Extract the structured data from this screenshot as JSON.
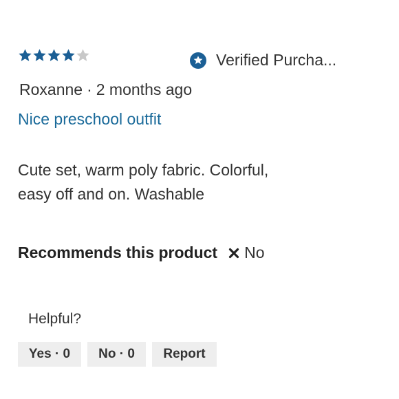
{
  "review": {
    "rating": 4,
    "max_rating": 5,
    "verified_label": "Verified Purcha...",
    "author": "Roxanne",
    "date": "2 months ago",
    "title": "Nice preschool outfit",
    "body_line1": "Cute set, warm poly fabric. Colorful,",
    "body_line2": "easy off and on. Washable",
    "recommends_label": "Recommends this product",
    "recommends_value": "No"
  },
  "helpful": {
    "label": "Helpful?",
    "yes_label": "Yes · 0",
    "no_label": "No · 0",
    "report_label": "Report"
  },
  "colors": {
    "star_filled": "#1b5f95",
    "star_empty": "#c8c8c8",
    "accent": "#1a6a9a",
    "button_bg": "#eeeeee"
  },
  "icons": {
    "star": "star-icon",
    "verified": "verified-badge-icon",
    "no": "x-icon"
  }
}
